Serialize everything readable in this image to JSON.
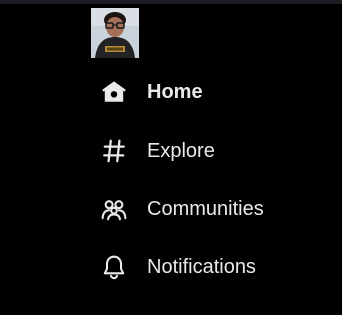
{
  "colors": {
    "background": "#000000",
    "text": "#e7e9ea",
    "top_strip": "#1b1d22"
  },
  "profile": {
    "avatar_icon": "user-avatar-photo"
  },
  "nav": {
    "items": [
      {
        "label": "Home",
        "icon": "home-icon",
        "active": true
      },
      {
        "label": "Explore",
        "icon": "hashtag-icon",
        "active": false
      },
      {
        "label": "Communities",
        "icon": "communities-icon",
        "active": false
      },
      {
        "label": "Notifications",
        "icon": "bell-icon",
        "active": false
      }
    ]
  }
}
